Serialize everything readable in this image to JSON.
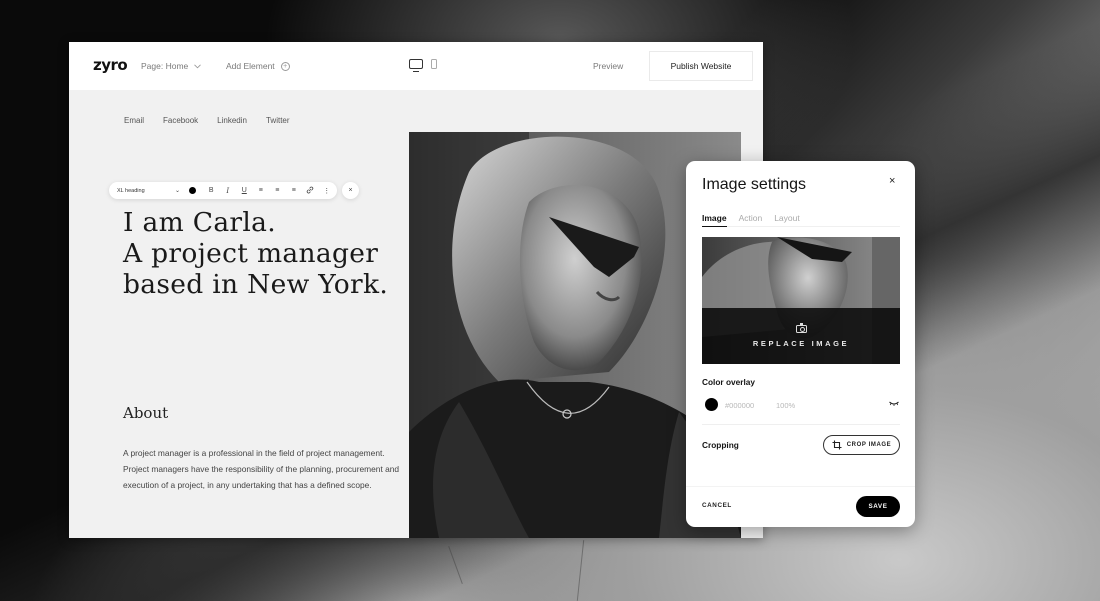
{
  "app": {
    "logo": "zyro",
    "page_selector": "Page: Home",
    "add_element": "Add Element",
    "preview": "Preview",
    "publish": "Publish Website"
  },
  "site": {
    "social_links": [
      "Email",
      "Facebook",
      "Linkedin",
      "Twitter"
    ],
    "heading_lines": [
      "I am Carla.",
      "A project manager",
      "based in New York."
    ],
    "about_title": "About",
    "about_body": "A project manager is a professional in the field of project management. Project managers have the responsibility of the planning, procurement and execution of a project, in any undertaking that has a defined scope."
  },
  "text_toolbar": {
    "style": "XL heading",
    "color": "#000000",
    "buttons": {
      "bold": "B",
      "italic": "I",
      "underline": "U",
      "more": "⋮",
      "close": "×"
    }
  },
  "image_settings": {
    "title": "Image settings",
    "close": "×",
    "tabs": [
      {
        "label": "Image",
        "active": true
      },
      {
        "label": "Action",
        "active": false
      },
      {
        "label": "Layout",
        "active": false
      }
    ],
    "replace_image": "REPLACE IMAGE",
    "color_overlay_label": "Color overlay",
    "overlay_color": "#000000",
    "overlay_hex_text": "#000000",
    "overlay_opacity": "100%",
    "cropping_label": "Cropping",
    "crop_button": "CROP IMAGE",
    "cancel": "CANCEL",
    "save": "SAVE"
  }
}
